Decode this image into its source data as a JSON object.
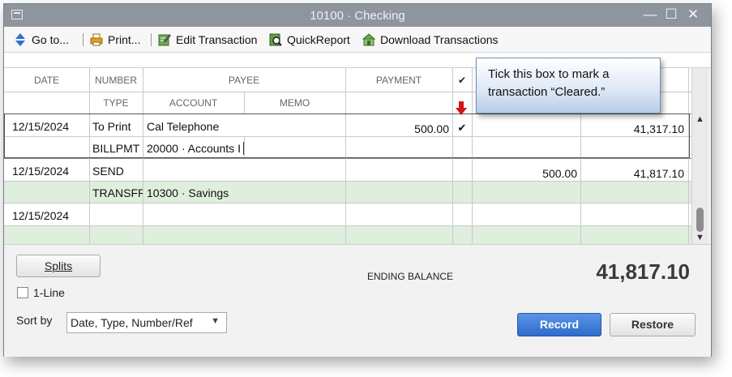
{
  "window": {
    "title": "10100 · Checking"
  },
  "title_controls": {
    "minimize": "—",
    "maximize": "☐",
    "close": "✕"
  },
  "toolbar": {
    "goto_label": "Go to...",
    "print_label": "Print...",
    "edit_label": "Edit Transaction",
    "quickreport_label": "QuickReport",
    "download_label": "Download Transactions"
  },
  "register": {
    "headers": {
      "date": "DATE",
      "number": "NUMBER",
      "payee": "PAYEE",
      "payment": "PAYMENT",
      "cleared": "✔",
      "type": "TYPE",
      "account": "ACCOUNT",
      "memo": "MEMO"
    },
    "transactions": [
      {
        "date": "12/15/2024",
        "number": "To Print",
        "payee": "Cal Telephone",
        "payment": "500.00",
        "cleared": "✔",
        "deposit": "",
        "balance": "41,317.10",
        "type": "BILLPMT",
        "account": "20000 · Accounts I",
        "memo": ""
      },
      {
        "date": "12/15/2024",
        "number": "SEND",
        "payee": "",
        "payment": "",
        "cleared": "",
        "deposit": "500.00",
        "balance": "41,817.10",
        "type": "TRANSFR",
        "account": "10300 · Savings",
        "memo": ""
      },
      {
        "date": "12/15/2024",
        "number": "",
        "payee": "",
        "payment": "",
        "cleared": "",
        "deposit": "",
        "balance": "",
        "type": "",
        "account": "",
        "memo": ""
      }
    ]
  },
  "bottom": {
    "splits_label": "Splits",
    "oneline_label": "1-Line",
    "sortby_label": "Sort by",
    "sort_value": "Date, Type, Number/Ref",
    "ending_balance_label": "ENDING BALANCE",
    "ending_balance_value": "41,817.10",
    "record_label": "Record",
    "restore_label": "Restore"
  },
  "callout": {
    "line1": "Tick this box to mark a",
    "line2": "transaction “Cleared.”"
  },
  "colors": {
    "titlebar": "#8e959d",
    "row_alt": "#dfeedd",
    "record_button": "#3b78d6",
    "marker": "#d31515"
  },
  "icons": [
    "goto-arrows-icon",
    "printer-icon",
    "edit-pencil-icon",
    "quickreport-icon",
    "download-icon",
    "red-down-arrow-icon",
    "chevron-down-icon",
    "scroll-up-icon",
    "scroll-down-icon"
  ]
}
